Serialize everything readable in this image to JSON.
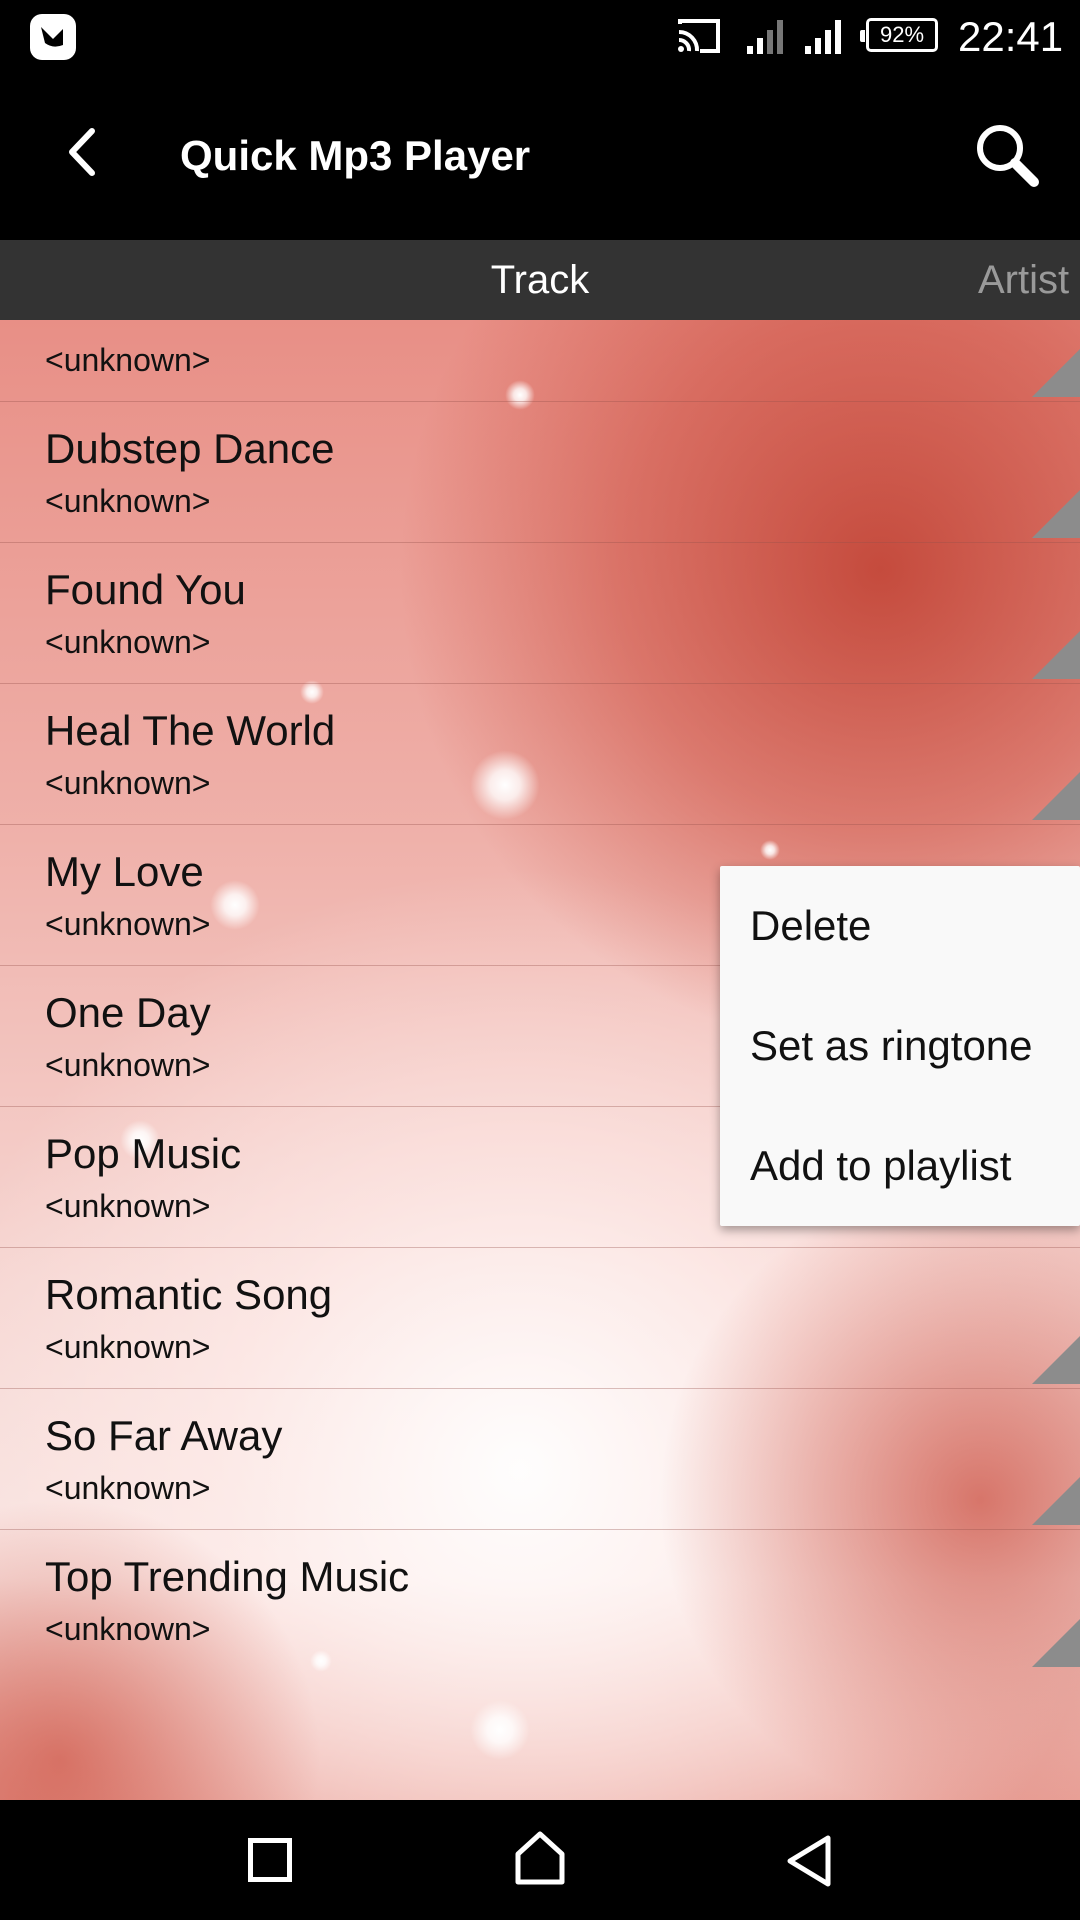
{
  "status_bar": {
    "battery": "92%",
    "time": "22:41",
    "icons": [
      "app-notification-icon",
      "cast-icon",
      "signal-icon",
      "signal-icon",
      "battery-icon"
    ]
  },
  "app_bar": {
    "title": "Quick Mp3 Player",
    "icons": [
      "back-arrow-icon",
      "search-icon"
    ]
  },
  "tabs": [
    {
      "label": "Track",
      "active": true
    },
    {
      "label": "Artist",
      "active": false
    }
  ],
  "tracks": [
    {
      "title": "",
      "artist": "<unknown>"
    },
    {
      "title": "Dubstep Dance",
      "artist": "<unknown>"
    },
    {
      "title": "Found You",
      "artist": "<unknown>"
    },
    {
      "title": "Heal The World",
      "artist": "<unknown>"
    },
    {
      "title": "My Love",
      "artist": "<unknown>"
    },
    {
      "title": "One Day",
      "artist": "<unknown>"
    },
    {
      "title": "Pop Music",
      "artist": "<unknown>"
    },
    {
      "title": "Romantic Song",
      "artist": "<unknown>"
    },
    {
      "title": "So Far Away",
      "artist": "<unknown>"
    },
    {
      "title": "Top Trending Music",
      "artist": "<unknown>"
    }
  ],
  "popup_menu": {
    "items": [
      "Delete",
      "Set as ringtone",
      "Add to playlist"
    ]
  },
  "nav_bar": {
    "icons": [
      "recent-apps-icon",
      "home-icon",
      "back-icon"
    ]
  },
  "colors": {
    "app_bar": "#000000",
    "tab_bar": "#333333",
    "tab_active_text": "#ffffff",
    "tab_inactive_text": "#9a9a9a",
    "background_accent": "#d9584a",
    "menu_background": "#f9f9f9"
  }
}
